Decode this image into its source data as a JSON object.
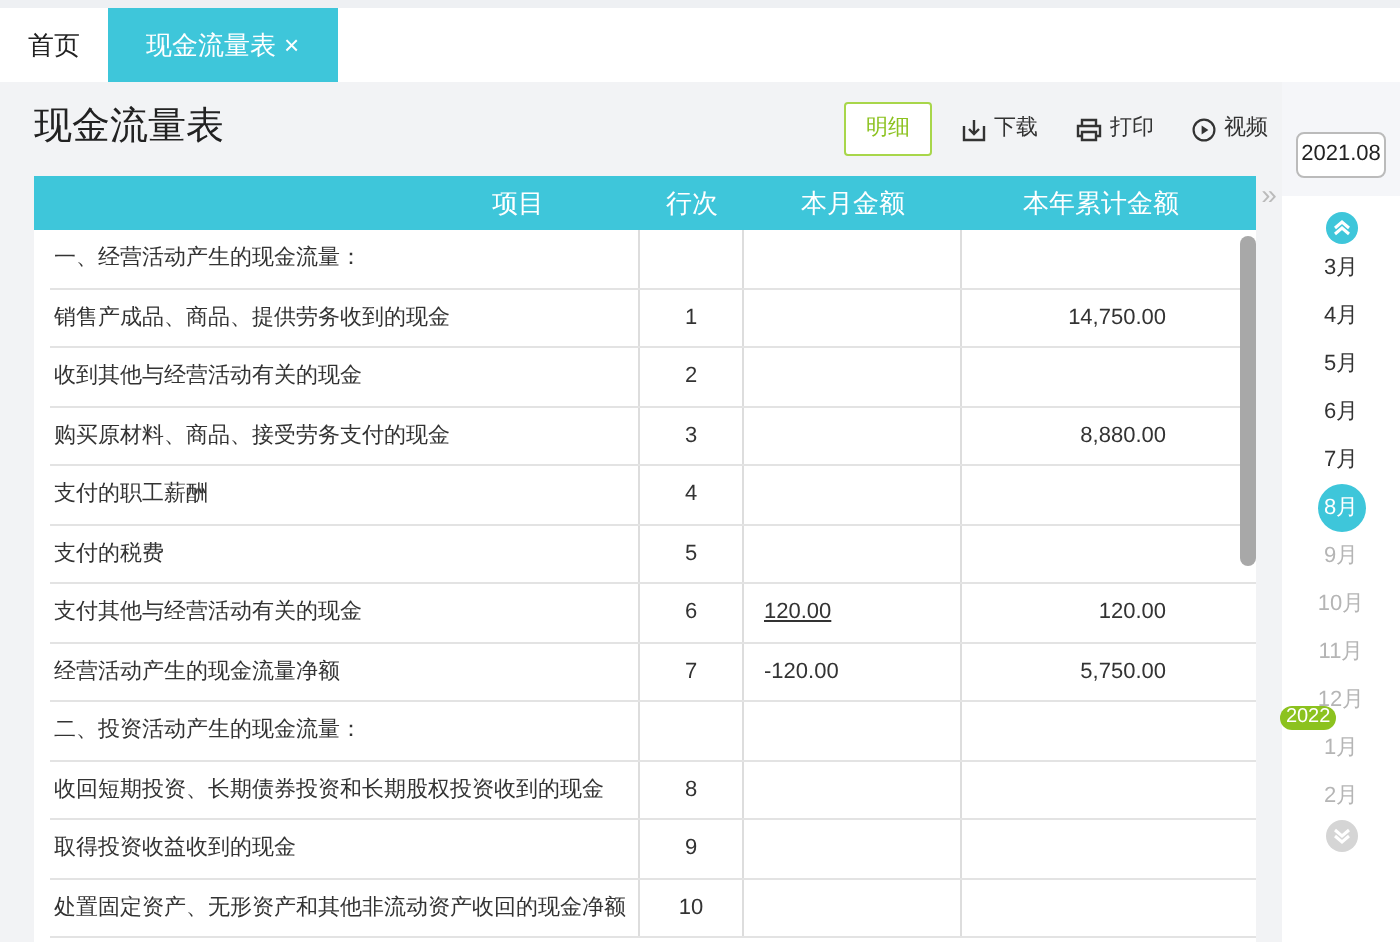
{
  "tabs": [
    {
      "label": "首页",
      "selected": false,
      "closable": false
    },
    {
      "label": "现金流量表",
      "selected": true,
      "closable": true
    }
  ],
  "close_glyph": "×",
  "page_title": "现金流量表",
  "toolbar": [
    {
      "label": "明细",
      "kind": "toggle",
      "selected": true
    },
    {
      "label": "下载",
      "kind": "download",
      "selected": false
    },
    {
      "label": "打印",
      "kind": "print",
      "selected": false
    },
    {
      "label": "视频",
      "kind": "video",
      "selected": false
    }
  ],
  "table": {
    "columns": [
      "项目",
      "行次",
      "本月金额",
      "本年累计金额"
    ],
    "rows": [
      {
        "item": "一、经营活动产生的现金流量：",
        "line": "",
        "month": "",
        "year": ""
      },
      {
        "item": "销售产成品、商品、提供劳务收到的现金",
        "line": "1",
        "month": "",
        "year": "14,750.00"
      },
      {
        "item": "收到其他与经营活动有关的现金",
        "line": "2",
        "month": "",
        "year": ""
      },
      {
        "item": "购买原材料、商品、接受劳务支付的现金",
        "line": "3",
        "month": "",
        "year": "8,880.00"
      },
      {
        "item": "支付的职工薪酬",
        "line": "4",
        "month": "",
        "year": ""
      },
      {
        "item": "支付的税费",
        "line": "5",
        "month": "",
        "year": ""
      },
      {
        "item": "支付其他与经营活动有关的现金",
        "line": "6",
        "month": "120.00",
        "year": "120.00",
        "month_link": true
      },
      {
        "item": "经营活动产生的现金流量净额",
        "line": "7",
        "month": "-120.00",
        "year": "5,750.00",
        "month_link": false
      },
      {
        "item": "二、投资活动产生的现金流量：",
        "line": "",
        "month": "",
        "year": ""
      },
      {
        "item": "收回短期投资、长期债券投资和长期股权投资收到的现金",
        "line": "8",
        "month": "",
        "year": ""
      },
      {
        "item": "取得投资收益收到的现金",
        "line": "9",
        "month": "",
        "year": ""
      },
      {
        "item": "处置固定资产、无形资产和其他非流动资产收回的现金净额",
        "line": "10",
        "month": "",
        "year": ""
      }
    ]
  },
  "collapse_glyph": "»",
  "period": {
    "value": "2021.08"
  },
  "months": [
    {
      "label": "3月",
      "selected": false,
      "disabled": false
    },
    {
      "label": "4月",
      "selected": false,
      "disabled": false
    },
    {
      "label": "5月",
      "selected": false,
      "disabled": false
    },
    {
      "label": "6月",
      "selected": false,
      "disabled": false
    },
    {
      "label": "7月",
      "selected": false,
      "disabled": false
    },
    {
      "label": "8月",
      "selected": true,
      "disabled": false
    },
    {
      "label": "9月",
      "selected": false,
      "disabled": true
    },
    {
      "label": "10月",
      "selected": false,
      "disabled": true
    },
    {
      "label": "11月",
      "selected": false,
      "disabled": true
    },
    {
      "label": "12月",
      "selected": false,
      "disabled": true
    },
    {
      "label": "1月",
      "selected": false,
      "disabled": true,
      "year_badge": "2022"
    },
    {
      "label": "2月",
      "selected": false,
      "disabled": true
    }
  ]
}
